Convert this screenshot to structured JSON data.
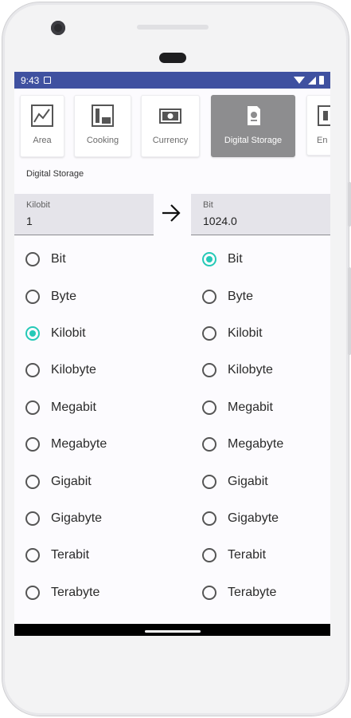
{
  "status_bar": {
    "time": "9:43"
  },
  "categories": [
    {
      "label": "Area",
      "icon": "area-chart-icon",
      "selected": false
    },
    {
      "label": "Cooking",
      "icon": "cooking-icon",
      "selected": false
    },
    {
      "label": "Currency",
      "icon": "currency-icon",
      "selected": false
    },
    {
      "label": "Digital Storage",
      "icon": "sd-card-icon",
      "selected": true
    },
    {
      "label": "En",
      "icon": "energy-icon",
      "selected": false
    }
  ],
  "section_title": "Digital Storage",
  "from_field": {
    "label": "Kilobit",
    "value": "1"
  },
  "to_field": {
    "label": "Bit",
    "value": "1024.0"
  },
  "units": [
    "Bit",
    "Byte",
    "Kilobit",
    "Kilobyte",
    "Megabit",
    "Megabyte",
    "Gigabit",
    "Gigabyte",
    "Terabit",
    "Terabyte"
  ],
  "from_selected": "Kilobit",
  "to_selected": "Bit",
  "colors": {
    "status_bar": "#3f51a0",
    "accent": "#25c9b7",
    "selected_card": "#8d8d8f"
  }
}
